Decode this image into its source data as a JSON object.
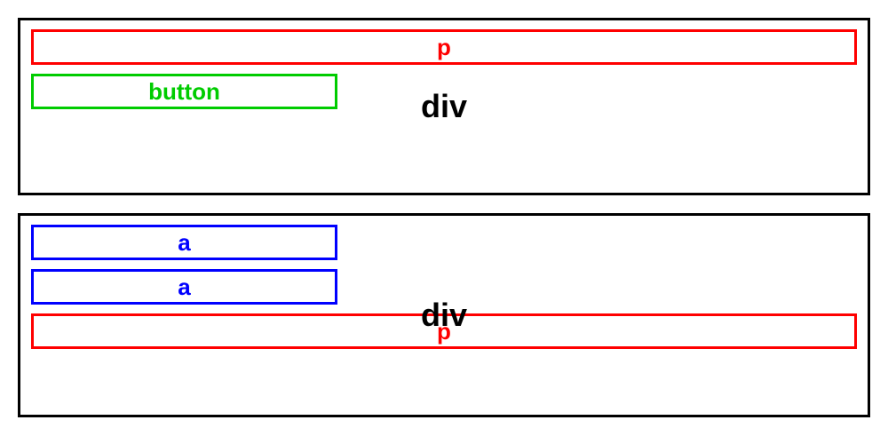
{
  "containers": [
    {
      "label": "div",
      "children": [
        {
          "type": "p",
          "label": "p"
        },
        {
          "type": "button",
          "label": "button"
        }
      ]
    },
    {
      "label": "div",
      "children": [
        {
          "type": "a",
          "label": "a"
        },
        {
          "type": "a",
          "label": "a"
        },
        {
          "type": "p",
          "label": "p"
        }
      ]
    }
  ]
}
